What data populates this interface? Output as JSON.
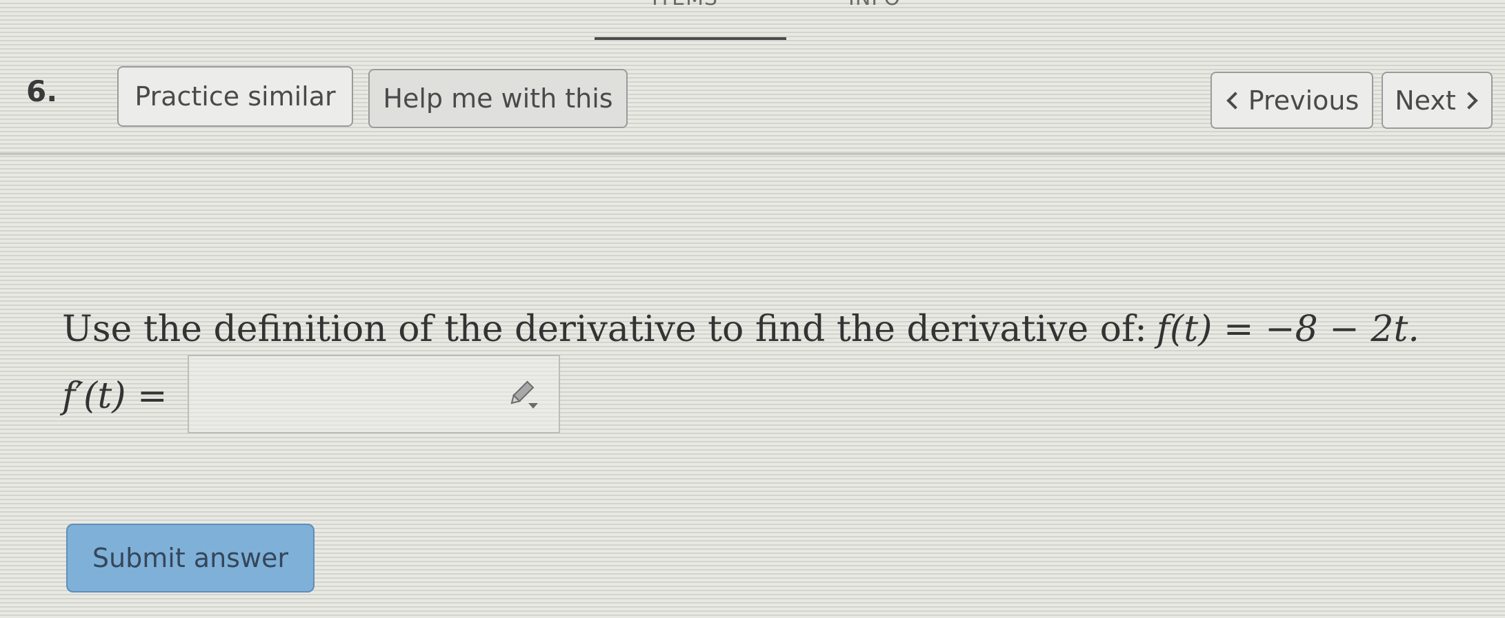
{
  "tabs": {
    "items_label": "ITEMS",
    "info_label": "INFO"
  },
  "question": {
    "number": "6.",
    "prompt": "Use the definition of the derivative to find the derivative of:",
    "function": "f(t) = −8 − 2t.",
    "answer_label": "f′(t) =",
    "answer_value": ""
  },
  "toolbar": {
    "practice_label": "Practice similar",
    "help_label": "Help me with this",
    "previous_label": "Previous",
    "next_label": "Next"
  },
  "submit": {
    "label": "Submit answer"
  },
  "icons": {
    "answer_tool": "pencil-icon",
    "previous": "chevron-left-icon",
    "next": "chevron-right-icon"
  },
  "colors": {
    "submit_bg": "#7fb0d8",
    "page_bg": "#e6e6e1"
  }
}
